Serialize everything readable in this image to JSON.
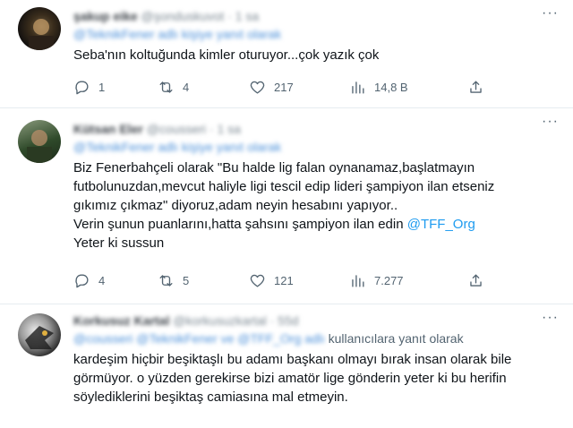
{
  "tweets": [
    {
      "author_name": "şakup eike",
      "author_handle": "@şonduskuvot · 1 sa",
      "replying_handle": "@TeknikFener",
      "replying_suffix": " adlı kişiye yanıt olarak",
      "text_parts": [
        "Seba'nın koltuğunda kimler oturuyor...çok yazık çok"
      ],
      "link": "",
      "text_after": "",
      "reply_count": "1",
      "retweet_count": "4",
      "like_count": "217",
      "view_count": "14,8 B"
    },
    {
      "author_name": "Kütsan Eler",
      "author_handle": "@cousseri · 1 sa",
      "replying_handle": "@TeknikFener",
      "replying_suffix": " adlı kişiye yanıt olarak",
      "text_parts": [
        "Biz Fenerbahçeli olarak \"Bu halde lig falan oynanamaz,başlatmayın\nfutbolunuzdan,mevcut haliyle ligi tescil edip lideri şampiyon ilan etseniz\ngıkımız çıkmaz\" diyoruz,adam neyin hesabını yapıyor..\nVerin şunun puanlarını,hatta şahsını şampiyon ilan edin "
      ],
      "link": "@TFF_Org",
      "text_after": "\nYeter ki sussun",
      "reply_count": "4",
      "retweet_count": "5",
      "like_count": "121",
      "view_count": "7.277"
    },
    {
      "author_name": "Korkusuz Kartal",
      "author_handle": "@korkusuzkartal · 55d",
      "replying_handle": "@cousseri @TeknikFener ve @TFF_Org adlı",
      "replying_suffix": " kullanıcılara yanıt olarak",
      "text_parts": [
        "kardeşim hiçbir beşiktaşlı bu adamı başkanı olmayı bırak insan olarak bile\ngörmüyor. o yüzden gerekirse bizi amatör lige gönderin yeter ki bu herifin\nsöylediklerini beşiktaş camiasına mal etmeyin."
      ],
      "link": "",
      "text_after": ""
    }
  ],
  "more_icon": "···",
  "icons": [
    "reply-icon",
    "retweet-icon",
    "like-icon",
    "views-icon",
    "share-icon",
    "more-icon"
  ],
  "colors": {
    "link": "#1d9bf0",
    "muted": "#536471",
    "divider": "#e6ecf0"
  }
}
